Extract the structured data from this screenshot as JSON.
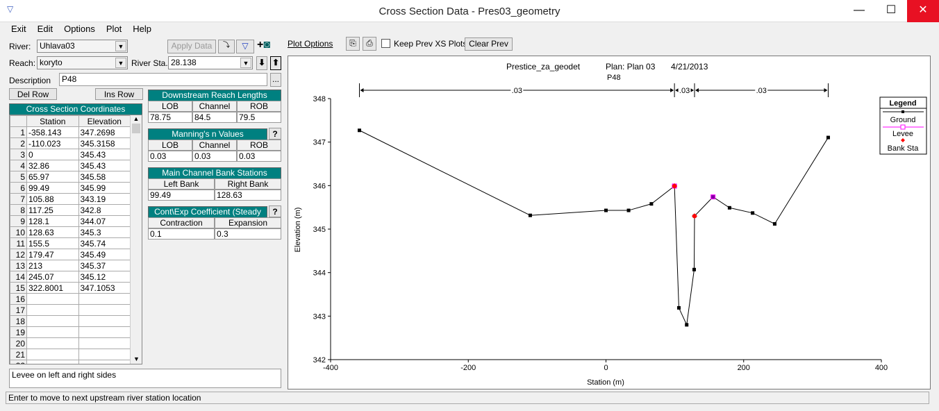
{
  "window": {
    "title": "Cross Section Data - Pres03_geometry",
    "minimize": "—",
    "maximize": "☐",
    "close": "✕"
  },
  "menu": [
    "Exit",
    "Edit",
    "Options",
    "Plot",
    "Help"
  ],
  "river": {
    "label": "River:",
    "value": "Uhlava03"
  },
  "reach": {
    "label": "Reach:",
    "value": "koryto"
  },
  "river_sta": {
    "label": "River Sta.:",
    "value": "28.138"
  },
  "description": {
    "label": "Description",
    "value": "P48"
  },
  "buttons": {
    "apply": "Apply Data",
    "del_row": "Del Row",
    "ins_row": "Ins Row",
    "plot_options": "Plot Options",
    "keep_prev": "Keep Prev XS Plots",
    "clear_prev": "Clear Prev",
    "more": "..."
  },
  "coords": {
    "title": "Cross Section Coordinates",
    "headers": [
      "Station",
      "Elevation"
    ],
    "rows": [
      [
        "-358.143",
        "347.2698"
      ],
      [
        "-110.023",
        "345.3158"
      ],
      [
        "0",
        "345.43"
      ],
      [
        "32.86",
        "345.43"
      ],
      [
        "65.97",
        "345.58"
      ],
      [
        "99.49",
        "345.99"
      ],
      [
        "105.88",
        "343.19"
      ],
      [
        "117.25",
        "342.8"
      ],
      [
        "128.1",
        "344.07"
      ],
      [
        "128.63",
        "345.3"
      ],
      [
        "155.5",
        "345.74"
      ],
      [
        "179.47",
        "345.49"
      ],
      [
        "213",
        "345.37"
      ],
      [
        "245.07",
        "345.12"
      ],
      [
        "322.8001",
        "347.1053"
      ],
      [
        "",
        ""
      ],
      [
        "",
        ""
      ],
      [
        "",
        ""
      ],
      [
        "",
        ""
      ],
      [
        "",
        ""
      ],
      [
        "",
        ""
      ],
      [
        "",
        ""
      ]
    ]
  },
  "reach_lengths": {
    "title": "Downstream Reach Lengths",
    "headers": [
      "LOB",
      "Channel",
      "ROB"
    ],
    "values": [
      "78.75",
      "84.5",
      "79.5"
    ]
  },
  "mannings": {
    "title": "Manning's n Values",
    "headers": [
      "LOB",
      "Channel",
      "ROB"
    ],
    "values": [
      "0.03",
      "0.03",
      "0.03"
    ]
  },
  "bank_stations": {
    "title": "Main Channel Bank Stations",
    "headers": [
      "Left Bank",
      "Right Bank"
    ],
    "values": [
      "99.49",
      "128.63"
    ]
  },
  "coefficients": {
    "title": "Cont\\Exp Coefficient (Steady Flow)",
    "headers": [
      "Contraction",
      "Expansion"
    ],
    "values": [
      "0.1",
      "0.3"
    ]
  },
  "notes": "Levee on left and right sides",
  "status": "Enter to move to next upstream river station location",
  "chart_data": {
    "type": "line",
    "title": "Prestice_za_geodet      Plan: Plan 03    4/21/2013",
    "title_parts": [
      "Prestice_za_geodet",
      "Plan: Plan 03",
      "4/21/2013"
    ],
    "subtitle": "P48",
    "xlabel": "Station (m)",
    "ylabel": "Elevation (m)",
    "xlim": [
      -400,
      400
    ],
    "ylim": [
      342,
      348
    ],
    "xticks": [
      -400,
      -200,
      0,
      200,
      400
    ],
    "yticks": [
      342,
      343,
      344,
      345,
      346,
      347,
      348
    ],
    "series": [
      {
        "name": "Ground",
        "color": "#000000",
        "x": [
          -358.143,
          -110.023,
          0,
          32.86,
          65.97,
          99.49,
          105.88,
          117.25,
          128.1,
          128.63,
          155.5,
          179.47,
          213,
          245.07,
          322.8001
        ],
        "y": [
          347.2698,
          345.3158,
          345.43,
          345.43,
          345.58,
          345.99,
          343.19,
          342.8,
          344.07,
          345.3,
          345.74,
          345.49,
          345.37,
          345.12,
          347.1053
        ]
      },
      {
        "name": "Levee",
        "color": "#ff00ff",
        "x": [
          99.49,
          155.5
        ],
        "y": [
          345.99,
          345.74
        ]
      },
      {
        "name": "Bank Sta",
        "color": "#ff0000",
        "x": [
          99.49,
          128.63
        ],
        "y": [
          345.99,
          345.3
        ]
      }
    ],
    "mannings_bar": {
      "breaks": [
        -358.143,
        99.49,
        128.63,
        322.8001
      ],
      "labels": [
        ".03",
        ".03",
        ".03"
      ]
    },
    "legend": {
      "title": "Legend",
      "placement": "top-right"
    }
  }
}
